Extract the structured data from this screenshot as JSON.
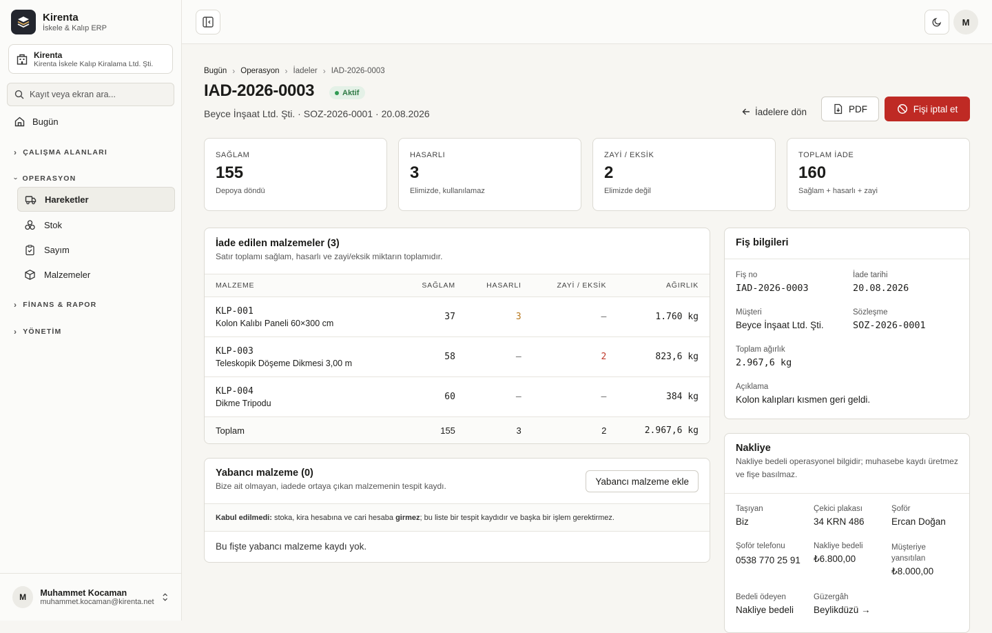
{
  "brand": {
    "name": "Kirenta",
    "subtitle": "İskele & Kalıp ERP"
  },
  "org": {
    "name": "Kirenta",
    "legal_name": "Kirenta İskele Kalıp Kiralama Ltd. Şti."
  },
  "search": {
    "placeholder": "Kayıt veya ekran ara..."
  },
  "nav": {
    "today": "Bugün",
    "groups": {
      "workspaces": "ÇALIŞMA ALANLARI",
      "operations": "OPERASYON",
      "finance": "FİNANS & RAPOR",
      "admin": "YÖNETİM"
    },
    "operations_items": [
      "Hareketler",
      "Stok",
      "Sayım",
      "Malzemeler"
    ]
  },
  "user": {
    "name": "Muhammet Kocaman",
    "email": "muhammet.kocaman@kirenta.net",
    "initial": "M"
  },
  "breadcrumb": [
    "Bugün",
    "Operasyon",
    "İadeler",
    "IAD-2026-0003"
  ],
  "page": {
    "title": "IAD-2026-0003",
    "status": "Aktif",
    "subtitle": "Beyce İnşaat Ltd. Şti. · SOZ-2026-0001 · 20.08.2026",
    "back_label": "İadelere dön",
    "pdf_label": "PDF",
    "cancel_label": "Fişi iptal et"
  },
  "stats": [
    {
      "label": "SAĞLAM",
      "value": "155",
      "note": "Depoya döndü"
    },
    {
      "label": "HASARLI",
      "value": "3",
      "note": "Elimizde, kullanılamaz"
    },
    {
      "label": "ZAYİ / EKSİK",
      "value": "2",
      "note": "Elimizde değil"
    },
    {
      "label": "TOPLAM İADE",
      "value": "160",
      "note": "Sağlam + hasarlı + zayi"
    }
  ],
  "materials": {
    "title": "İade edilen malzemeler (3)",
    "subtitle": "Satır toplamı sağlam, hasarlı ve zayi/eksik miktarın toplamıdır.",
    "columns": [
      "MALZEME",
      "SAĞLAM",
      "HASARLI",
      "ZAYİ / EKSİK",
      "AĞIRLIK"
    ],
    "rows": [
      {
        "code": "KLP-001",
        "name": "Kolon Kalıbı Paneli 60×300 cm",
        "ok": "37",
        "damaged": "3",
        "lost": "—",
        "weight": "1.760 kg"
      },
      {
        "code": "KLP-003",
        "name": "Teleskopik Döşeme Dikmesi 3,00 m",
        "ok": "58",
        "damaged": "—",
        "lost": "2",
        "weight": "823,6 kg"
      },
      {
        "code": "KLP-004",
        "name": "Dikme Tripodu",
        "ok": "60",
        "damaged": "—",
        "lost": "—",
        "weight": "384 kg"
      }
    ],
    "total": {
      "label": "Toplam",
      "ok": "155",
      "damaged": "3",
      "lost": "2",
      "weight": "2.967,6 kg"
    }
  },
  "foreign": {
    "title": "Yabancı malzeme (0)",
    "subtitle": "Bize ait olmayan, iadede ortaya çıkan malzemenin tespit kaydı.",
    "add_label": "Yabancı malzeme ekle",
    "note_bold": "Kabul edilmedi:",
    "note_a": " stoka, kira hesabına ve cari hesaba ",
    "note_bold2": "girmez",
    "note_b": "; bu liste bir tespit kaydıdır ve başka bir işlem gerektirmez.",
    "empty": "Bu fişte yabancı malzeme kaydı yok."
  },
  "receipt": {
    "title": "Fiş bilgileri",
    "no_label": "Fiş no",
    "no": "IAD-2026-0003",
    "date_label": "İade tarihi",
    "date": "20.08.2026",
    "customer_label": "Müşteri",
    "customer": "Beyce İnşaat Ltd. Şti.",
    "contract_label": "Sözleşme",
    "contract": "SOZ-2026-0001",
    "weight_label": "Toplam ağırlık",
    "weight": "2.967,6 kg",
    "desc_label": "Açıklama",
    "desc": "Kolon kalıpları kısmen geri geldi."
  },
  "shipping": {
    "title": "Nakliye",
    "subtitle": "Nakliye bedeli operasyonel bilgidir; muhasebe kaydı üretmez ve fişe basılmaz.",
    "carrier_label": "Taşıyan",
    "carrier": "Biz",
    "plate_label": "Çekici plakası",
    "plate": "34 KRN 486",
    "driver_label": "Şoför",
    "driver": "Ercan Doğan",
    "phone_label": "Şoför telefonu",
    "phone": "0538 770 25 91",
    "fee_label": "Nakliye bedeli",
    "fee": "₺6.800,00",
    "billed_label": "Müşteriye yansıtılan",
    "billed": "₺8.000,00",
    "payer_label": "Bedeli ödeyen",
    "payer": "Nakliye bedeli",
    "route_label": "Güzergâh",
    "route": "Beylikdüzü →"
  },
  "colors": {
    "accent_red": "#bf2a24",
    "status_green": "#2f7a45",
    "damaged_amber": "#b7791f",
    "lost_red": "#c0392b"
  }
}
